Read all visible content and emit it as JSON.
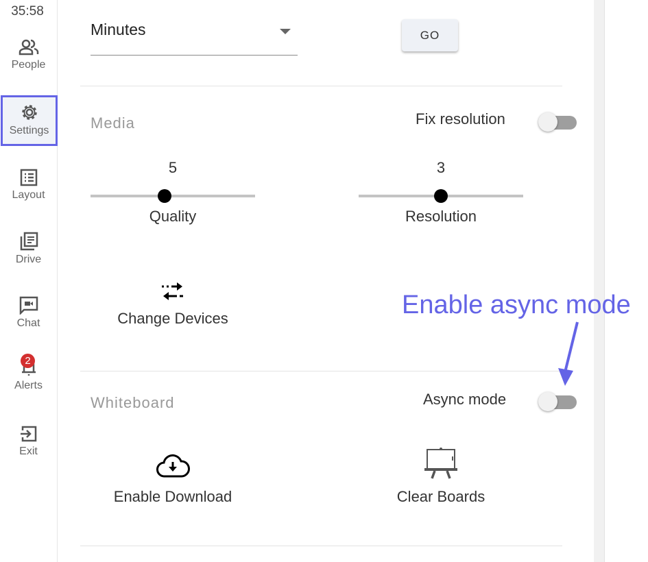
{
  "sidebar": {
    "timer": "35:58",
    "items": [
      {
        "label": "People",
        "icon": "people-icon"
      },
      {
        "label": "Settings",
        "icon": "gear-icon",
        "active": true
      },
      {
        "label": "Layout",
        "icon": "layout-icon"
      },
      {
        "label": "Drive",
        "icon": "drive-icon"
      },
      {
        "label": "Chat",
        "icon": "chat-icon"
      },
      {
        "label": "Alerts",
        "icon": "bell-icon",
        "badge": "2"
      },
      {
        "label": "Exit",
        "icon": "exit-icon"
      }
    ]
  },
  "extend": {
    "unit_value": "Minutes",
    "go_label": "GO"
  },
  "media": {
    "title": "Media",
    "fix_resolution_label": "Fix resolution",
    "fix_resolution_on": false,
    "quality": {
      "label": "Quality",
      "value": "5",
      "fraction": 0.45
    },
    "resolution": {
      "label": "Resolution",
      "value": "3",
      "fraction": 0.5
    },
    "change_devices": "Change Devices"
  },
  "whiteboard": {
    "title": "Whiteboard",
    "async_label": "Async mode",
    "async_on": false,
    "enable_download": "Enable Download",
    "clear_boards": "Clear Boards"
  },
  "annotation": {
    "text": "Enable async mode",
    "color": "#6464e6"
  }
}
